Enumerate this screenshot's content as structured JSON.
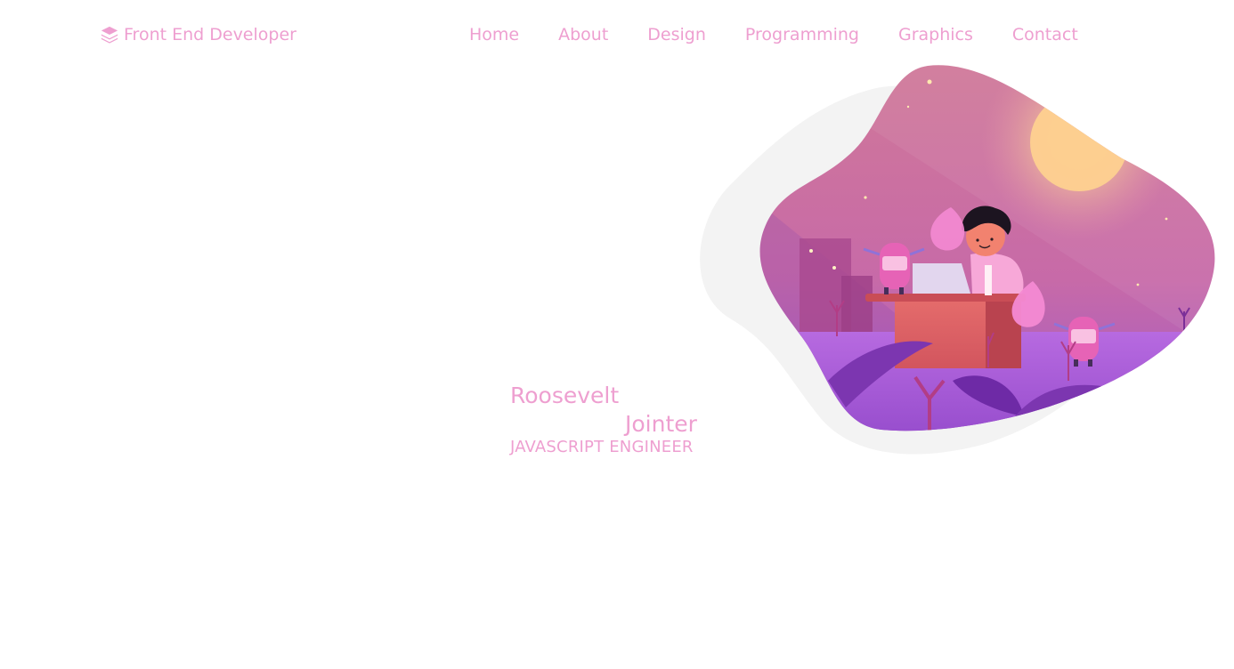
{
  "brand": {
    "label": "Front End Developer",
    "icon": "layers-icon",
    "color": "#ee9fd0"
  },
  "nav": {
    "items": [
      {
        "label": "Home"
      },
      {
        "label": "About"
      },
      {
        "label": "Design"
      },
      {
        "label": "Programming"
      },
      {
        "label": "Graphics"
      },
      {
        "label": "Contact"
      }
    ]
  },
  "hero": {
    "first_name": "Roosevelt",
    "last_name": "Jointer",
    "role": "JAVASCRIPT ENGINEER",
    "illustration": "developer-at-desk-illustration"
  },
  "colors": {
    "accent": "#ee9fd0",
    "blob_shadow": "#f3f3f3",
    "sky_top": "#d07898",
    "sky_bottom": "#a35cd0",
    "ground": "#b266dc"
  }
}
